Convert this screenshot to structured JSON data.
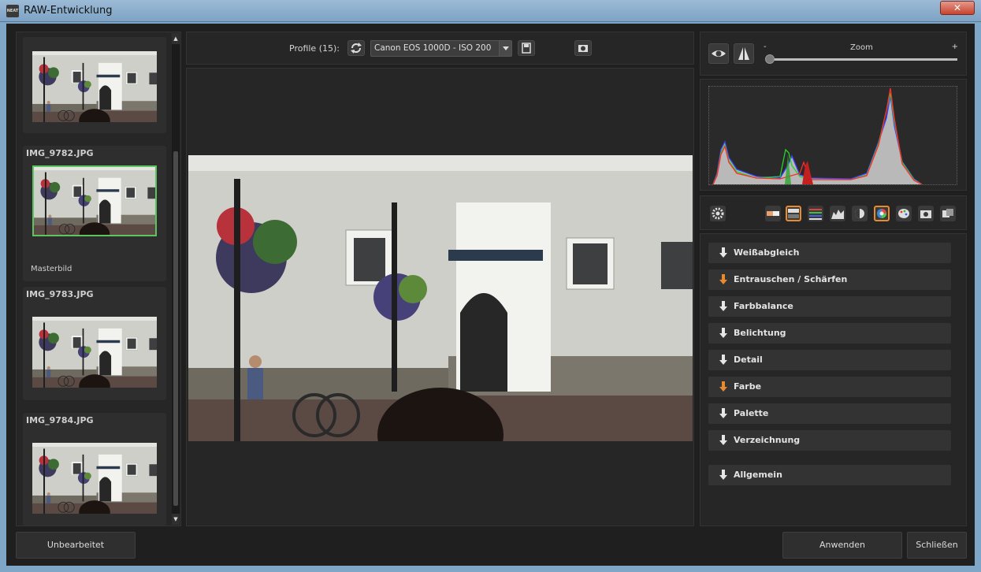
{
  "window": {
    "title": "RAW-Entwicklung",
    "close_glyph": "✕",
    "app_icon_text": "NEAT"
  },
  "filmstrip": {
    "items": [
      {
        "name": "",
        "sub": ""
      },
      {
        "name": "IMG_9782.JPG",
        "sub": "Masterbild"
      },
      {
        "name": "IMG_9783.JPG",
        "sub": ""
      },
      {
        "name": "IMG_9784.JPG",
        "sub": ""
      }
    ]
  },
  "toolbar": {
    "profile_label": "Profile (15):",
    "profile_value": "Canon EOS 1000D - ISO 200"
  },
  "zoom": {
    "label": "Zoom",
    "minus": "-",
    "plus": "+",
    "level": 0
  },
  "sections": [
    {
      "label": "Weißabgleich",
      "modified": false
    },
    {
      "label": "Entrauschen / Schärfen",
      "modified": true
    },
    {
      "label": "Farbbalance",
      "modified": false
    },
    {
      "label": "Belichtung",
      "modified": false
    },
    {
      "label": "Detail",
      "modified": false
    },
    {
      "label": "Farbe",
      "modified": true
    },
    {
      "label": "Palette",
      "modified": false
    },
    {
      "label": "Verzeichnung",
      "modified": false
    },
    {
      "label": "Allgemein",
      "modified": false
    }
  ],
  "colors": {
    "accent_orange": "#e88a2e",
    "arrow_white": "#e6e6e6",
    "selection_green": "#5ec45e"
  },
  "footer": {
    "unedited": "Unbearbeitet",
    "apply": "Anwenden",
    "close": "Schließen"
  }
}
